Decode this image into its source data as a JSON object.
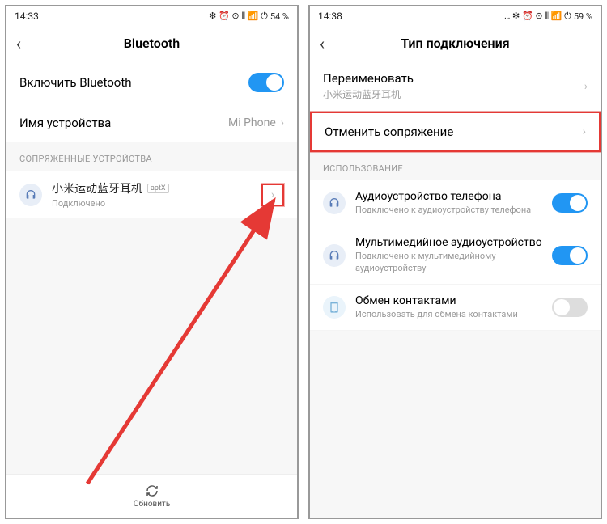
{
  "left": {
    "status": {
      "time": "14:33",
      "battery": "54 %",
      "icons": "✻ ⏰ ⊙ ⫴ 📶 ⏻"
    },
    "title": "Bluetooth",
    "enable_label": "Включить Bluetooth",
    "enable_on": true,
    "device_name_label": "Имя устройства",
    "device_name_value": "Mi Phone",
    "paired_section": "СОПРЯЖЕННЫЕ УСТРОЙСТВА",
    "device": {
      "name": "小米运动蓝牙耳机",
      "codec": "aptX",
      "status": "Подключено"
    },
    "refresh": "Обновить"
  },
  "right": {
    "status": {
      "time": "14:38",
      "battery": "59 %",
      "icons": "… ✻ ⏰ ⊙ ⫴ 📶 ⏻"
    },
    "title": "Тип подключения",
    "rename_label": "Переименовать",
    "rename_sub": "小米运动蓝牙耳机",
    "unpair_label": "Отменить сопряжение",
    "usage_section": "ИСПОЛЬЗОВАНИЕ",
    "options": [
      {
        "title": "Аудиоустройство телефона",
        "sub": "Подключено к аудиоустройству телефона",
        "on": true,
        "icon": "headphones"
      },
      {
        "title": "Мультимедийное аудиоустройство",
        "sub": "Подключено к мультимедийному аудиоустройству",
        "on": true,
        "icon": "headphones"
      },
      {
        "title": "Обмен контактами",
        "sub": "Использовать для обмена контактами",
        "on": false,
        "icon": "phone"
      }
    ]
  }
}
